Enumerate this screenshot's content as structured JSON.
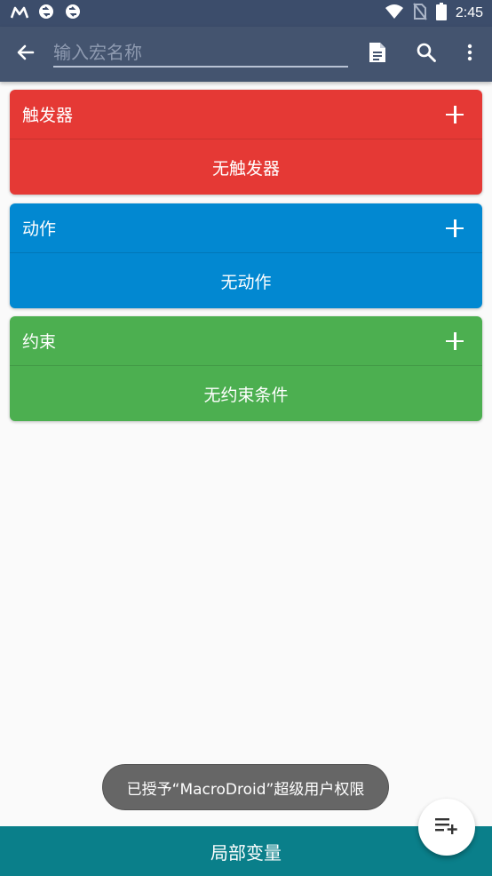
{
  "status_bar": {
    "time": "2:45",
    "left_icons": [
      "macrodroid-m-icon",
      "sync-icon",
      "sync-icon"
    ],
    "right_icons": [
      "wifi-icon",
      "no-sim-icon",
      "battery-icon"
    ]
  },
  "toolbar": {
    "name_placeholder": "输入宏名称",
    "icons": [
      "back-arrow-icon",
      "document-icon",
      "search-icon",
      "more-vert-icon"
    ]
  },
  "sections": {
    "triggers": {
      "title": "触发器",
      "empty_text": "无触发器",
      "color": "#e53935"
    },
    "actions": {
      "title": "动作",
      "empty_text": "无动作",
      "color": "#0288d1"
    },
    "constraints": {
      "title": "约束",
      "empty_text": "无约束条件",
      "color": "#4caf50"
    }
  },
  "toast": {
    "text": "已授予“MacroDroid”超级用户权限"
  },
  "bottom_bar": {
    "label": "局部变量",
    "color": "#0a7f8a"
  },
  "fab": {
    "icon": "playlist-add-icon"
  }
}
